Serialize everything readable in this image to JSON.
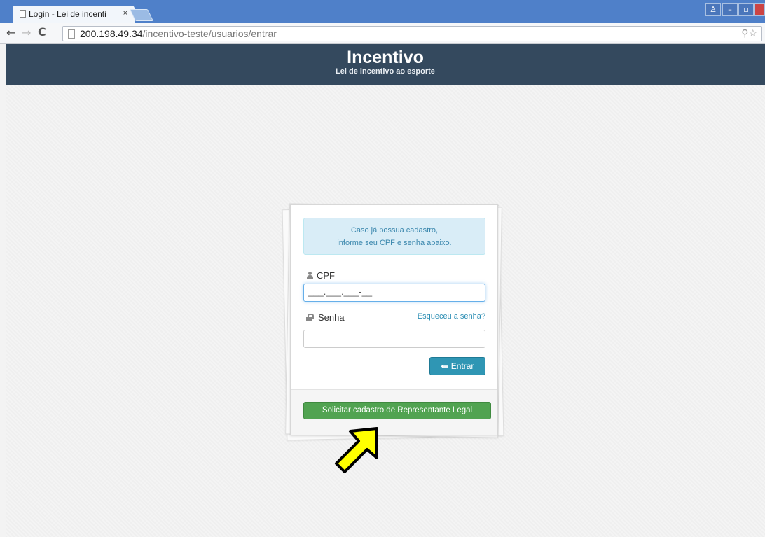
{
  "browser": {
    "tab_title": "Login - Lei de incenti",
    "tab_close": "×",
    "url_host": "200.198.49.34",
    "url_path": "/incentivo-teste/usuarios/entrar",
    "back": "←",
    "forward": "→",
    "reload": "C",
    "window_user": "♙",
    "window_min": "–",
    "window_max": "▫",
    "omni_icons": "⚲☆"
  },
  "header": {
    "title": "Incentivo",
    "subtitle": "Lei de incentivo ao esporte"
  },
  "login": {
    "info_line1": "Caso já possua cadastro,",
    "info_line2": "informe seu CPF e senha abaixo.",
    "cpf_label": "CPF",
    "cpf_value": "___.___.___-__",
    "senha_label": "Senha",
    "forgot_link": "Esqueceu a senha?",
    "senha_value": "",
    "entrar_icon": "⇚",
    "entrar_button": "Entrar",
    "solicitar_button": "Solicitar cadastro de Representante Legal"
  },
  "annotation": {
    "arrow_color": "#ffff00"
  }
}
